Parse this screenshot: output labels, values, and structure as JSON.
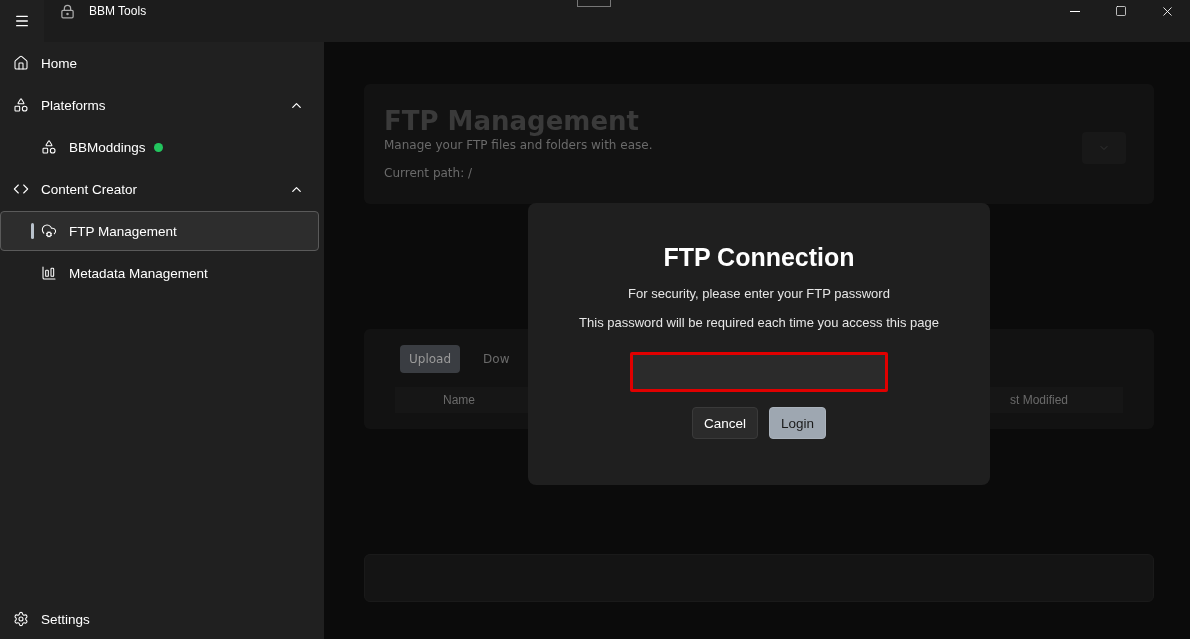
{
  "window": {
    "title": "BBM Tools"
  },
  "sidebar": {
    "items": [
      {
        "label": "Home",
        "selected": false
      },
      {
        "label": "Plateforms",
        "expanded": true,
        "selected": false,
        "children": [
          {
            "label": "BBModdings",
            "selected": false,
            "color": "#22c55e"
          }
        ]
      },
      {
        "label": "Content Creator",
        "expanded": true,
        "selected": false,
        "children": [
          {
            "label": "FTP Management",
            "selected": true
          },
          {
            "label": "Metadata Management",
            "selected": false
          }
        ]
      }
    ],
    "footer": {
      "label": "Settings"
    }
  },
  "page": {
    "title": "FTP Management",
    "subtitle": "Manage your FTP files and folders with ease.",
    "path": "Current path: /",
    "tabs": [
      {
        "label": "Upload",
        "selected": true
      },
      {
        "label": "Dow",
        "selected": false
      }
    ],
    "columns": [
      "Name",
      "st Modified"
    ]
  },
  "dialog": {
    "title": "FTP Connection",
    "lines": [
      "For security, please enter your FTP password",
      "This password will be required each time you access this page"
    ],
    "password": {
      "highlighted": true
    },
    "buttons": [
      {
        "label": "Cancel",
        "kind": "secondary"
      },
      {
        "label": "Login",
        "kind": "primary"
      }
    ]
  }
}
